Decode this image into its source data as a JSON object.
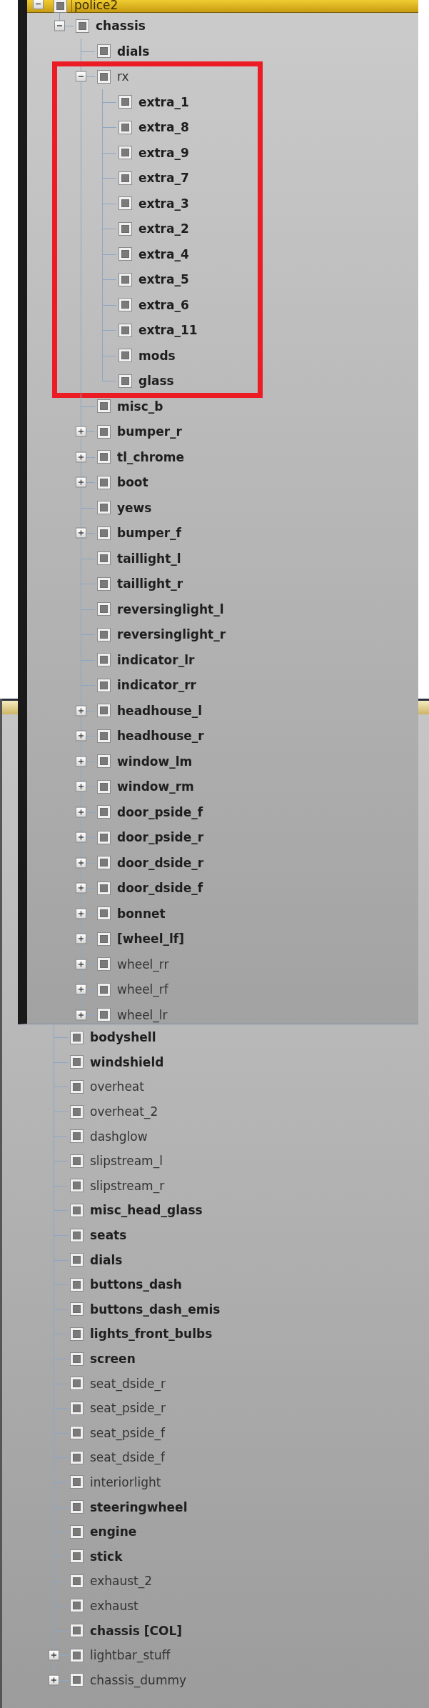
{
  "back_panel": {
    "items": [
      {
        "label": "bodyshell",
        "bold": true,
        "checked": true
      },
      {
        "label": "windshield",
        "bold": true,
        "checked": true
      },
      {
        "label": "overheat",
        "bold": false,
        "checked": true
      },
      {
        "label": "overheat_2",
        "bold": false,
        "checked": true
      },
      {
        "label": "dashglow",
        "bold": false,
        "checked": true
      },
      {
        "label": "slipstream_l",
        "bold": false,
        "checked": true
      },
      {
        "label": "slipstream_r",
        "bold": false,
        "checked": true
      },
      {
        "label": "misc_head_glass",
        "bold": true,
        "checked": true
      },
      {
        "label": "seats",
        "bold": true,
        "checked": true
      },
      {
        "label": "dials",
        "bold": true,
        "checked": true
      },
      {
        "label": "buttons_dash",
        "bold": true,
        "checked": true
      },
      {
        "label": "buttons_dash_emis",
        "bold": true,
        "checked": true
      },
      {
        "label": "lights_front_bulbs",
        "bold": true,
        "checked": true
      },
      {
        "label": "screen",
        "bold": true,
        "checked": true
      },
      {
        "label": "seat_dside_r",
        "bold": false,
        "checked": true
      },
      {
        "label": "seat_pside_r",
        "bold": false,
        "checked": true
      },
      {
        "label": "seat_pside_f",
        "bold": false,
        "checked": true
      },
      {
        "label": "seat_dside_f",
        "bold": false,
        "checked": true
      },
      {
        "label": "interiorlight",
        "bold": false,
        "checked": true
      },
      {
        "label": "steeringwheel",
        "bold": true,
        "checked": true
      },
      {
        "label": "engine",
        "bold": true,
        "checked": true
      },
      {
        "label": "stick",
        "bold": true,
        "checked": true
      },
      {
        "label": "exhaust_2",
        "bold": false,
        "checked": true
      },
      {
        "label": "exhaust",
        "bold": false,
        "checked": true
      },
      {
        "label": "chassis [COL]",
        "bold": true,
        "checked": true
      },
      {
        "label": "lightbar_stuff",
        "bold": false,
        "checked": true,
        "expanded": false
      },
      {
        "label": "chassis_dummy",
        "bold": false,
        "checked": true,
        "expanded": false
      }
    ]
  },
  "front_panel": {
    "title": "police2",
    "expanded": true,
    "checked": true,
    "children": [
      {
        "label": "chassis",
        "bold": true,
        "checked": true,
        "expanded": true,
        "children": [
          {
            "label": "dials",
            "bold": true,
            "checked": true,
            "highlighted": false
          },
          {
            "label": "rx",
            "bold": false,
            "checked": true,
            "expanded": true,
            "highlighted": true,
            "children": [
              {
                "label": "extra_1",
                "bold": true,
                "checked": true
              },
              {
                "label": "extra_8",
                "bold": true,
                "checked": true
              },
              {
                "label": "extra_9",
                "bold": true,
                "checked": true
              },
              {
                "label": "extra_7",
                "bold": true,
                "checked": true
              },
              {
                "label": "extra_3",
                "bold": true,
                "checked": true
              },
              {
                "label": "extra_2",
                "bold": true,
                "checked": true
              },
              {
                "label": "extra_4",
                "bold": true,
                "checked": true
              },
              {
                "label": "extra_5",
                "bold": true,
                "checked": true
              },
              {
                "label": "extra_6",
                "bold": true,
                "checked": true
              },
              {
                "label": "extra_11",
                "bold": true,
                "checked": true
              },
              {
                "label": "mods",
                "bold": true,
                "checked": true
              },
              {
                "label": "glass",
                "bold": true,
                "checked": true
              }
            ]
          },
          {
            "label": "misc_b",
            "bold": true,
            "checked": true,
            "highlighted": false
          },
          {
            "label": "bumper_r",
            "bold": true,
            "checked": true,
            "expanded": false,
            "highlighted": false
          },
          {
            "label": "tl_chrome",
            "bold": true,
            "checked": true,
            "expanded": false,
            "highlighted": false
          },
          {
            "label": "boot",
            "bold": true,
            "checked": true,
            "expanded": false,
            "highlighted": false
          },
          {
            "label": "yews",
            "bold": true,
            "checked": true,
            "highlighted": false
          },
          {
            "label": "bumper_f",
            "bold": true,
            "checked": true,
            "expanded": false,
            "highlighted": false
          },
          {
            "label": "taillight_l",
            "bold": true,
            "checked": true,
            "highlighted": false
          },
          {
            "label": "taillight_r",
            "bold": true,
            "checked": true,
            "highlighted": false
          },
          {
            "label": "reversinglight_l",
            "bold": true,
            "checked": true,
            "highlighted": false
          },
          {
            "label": "reversinglight_r",
            "bold": true,
            "checked": true,
            "highlighted": false
          },
          {
            "label": "indicator_lr",
            "bold": true,
            "checked": true,
            "highlighted": false
          },
          {
            "label": "indicator_rr",
            "bold": true,
            "checked": true,
            "highlighted": false
          },
          {
            "label": "headhouse_l",
            "bold": true,
            "checked": true,
            "expanded": false,
            "highlighted": false
          },
          {
            "label": "headhouse_r",
            "bold": true,
            "checked": true,
            "expanded": false,
            "highlighted": false
          },
          {
            "label": "window_lm",
            "bold": true,
            "checked": true,
            "expanded": false,
            "highlighted": false
          },
          {
            "label": "window_rm",
            "bold": true,
            "checked": true,
            "expanded": false,
            "highlighted": false
          },
          {
            "label": "door_pside_f",
            "bold": true,
            "checked": true,
            "expanded": false,
            "highlighted": false
          },
          {
            "label": "door_pside_r",
            "bold": true,
            "checked": true,
            "expanded": false,
            "highlighted": false
          },
          {
            "label": "door_dside_r",
            "bold": true,
            "checked": true,
            "expanded": false,
            "highlighted": false
          },
          {
            "label": "door_dside_f",
            "bold": true,
            "checked": true,
            "expanded": false,
            "highlighted": false
          },
          {
            "label": "bonnet",
            "bold": true,
            "checked": true,
            "expanded": false,
            "highlighted": false
          },
          {
            "label": "[wheel_lf]",
            "bold": true,
            "checked": true,
            "expanded": false,
            "highlighted": false
          },
          {
            "label": "wheel_rr",
            "bold": false,
            "checked": true,
            "expanded": false,
            "highlighted": false
          },
          {
            "label": "wheel_rf",
            "bold": false,
            "checked": true,
            "expanded": false,
            "highlighted": false
          },
          {
            "label": "wheel_lr",
            "bold": false,
            "checked": true,
            "expanded": false,
            "highlighted": false
          }
        ]
      }
    ]
  }
}
